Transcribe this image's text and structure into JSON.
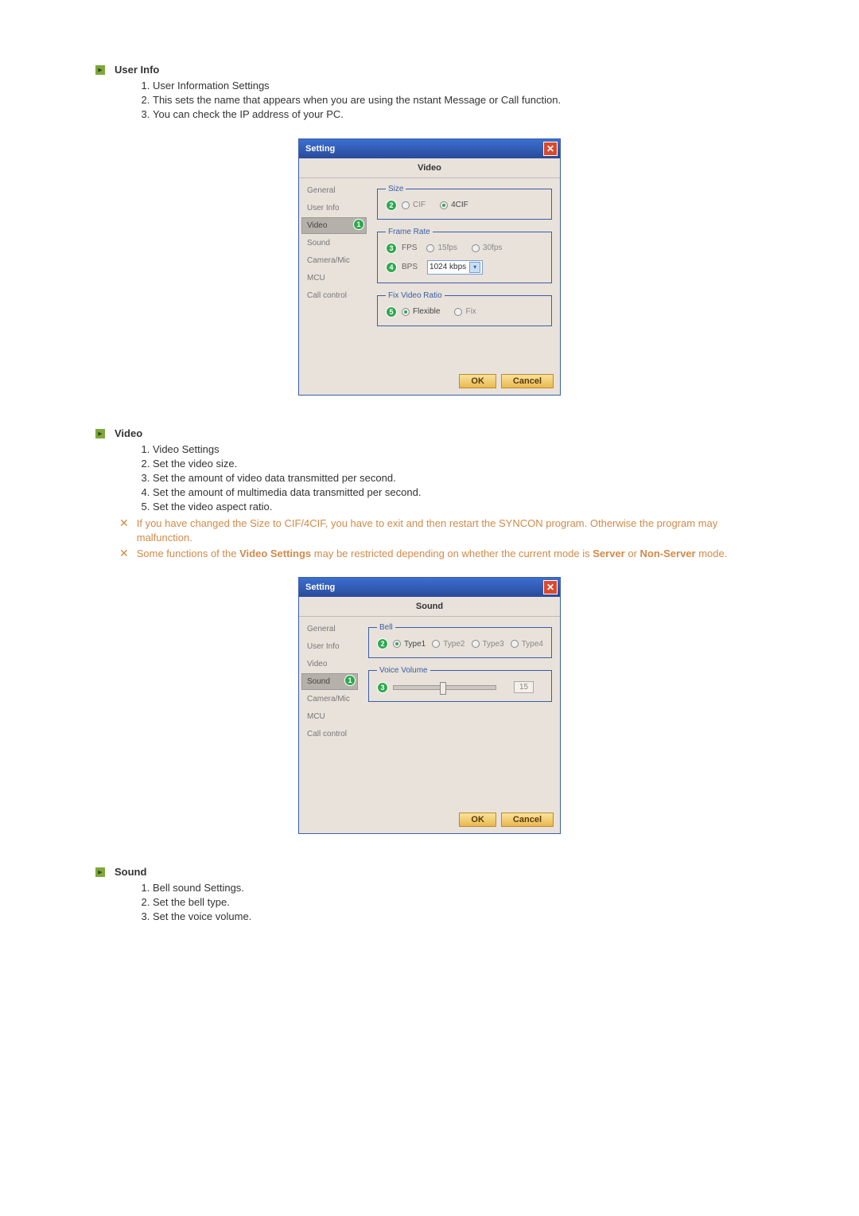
{
  "sections": {
    "userinfo": {
      "title": "User Info",
      "items": [
        "User Information Settings",
        "This sets the name that appears when you are using the nstant Message or Call function.",
        "You can check the IP address of your PC."
      ]
    },
    "video": {
      "title": "Video",
      "items": [
        "Video Settings",
        "Set the video size.",
        "Set the amount of video data transmitted per second.",
        "Set the amount of multimedia data transmitted per second.",
        "Set the video aspect ratio."
      ],
      "warning1": "If you have changed the Size to CIF/4CIF, you have to exit and then restart the SYNCON program. Otherwise the program may malfunction.",
      "warning2_a": "Some functions of the ",
      "warning2_b": "Video Settings",
      "warning2_c": " may be restricted depending on whether the current mode is ",
      "warning2_d": "Server",
      "warning2_e": " or ",
      "warning2_f": "Non-Server",
      "warning2_g": " mode."
    },
    "sound": {
      "title": "Sound",
      "items": [
        "Bell sound Settings.",
        "Set the bell type.",
        "Set the voice volume."
      ]
    }
  },
  "dialog": {
    "title": "Setting",
    "ok": "OK",
    "cancel": "Cancel",
    "sidebar": [
      "General",
      "User Info",
      "Video",
      "Sound",
      "Camera/Mic",
      "MCU",
      "Call control"
    ]
  },
  "videoDialog": {
    "tabTitle": "Video",
    "activeIndex": 2,
    "size": {
      "legend": "Size",
      "cif": "CIF",
      "cif4": "4CIF"
    },
    "frameRate": {
      "legend": "Frame Rate",
      "fps": "FPS",
      "fps15": "15fps",
      "fps30": "30fps",
      "bps": "BPS",
      "selected": "1024 kbps"
    },
    "ratio": {
      "legend": "Fix Video Ratio",
      "flexible": "Flexible",
      "fix": "Fix"
    },
    "badges": {
      "n1": "1",
      "n2": "2",
      "n3": "3",
      "n4": "4",
      "n5": "5"
    }
  },
  "soundDialog": {
    "tabTitle": "Sound",
    "activeIndex": 3,
    "bell": {
      "legend": "Bell",
      "t1": "Type1",
      "t2": "Type2",
      "t3": "Type3",
      "t4": "Type4"
    },
    "vol": {
      "legend": "Voice Volume",
      "value": "15"
    },
    "badges": {
      "n1": "1",
      "n2": "2",
      "n3": "3"
    }
  }
}
